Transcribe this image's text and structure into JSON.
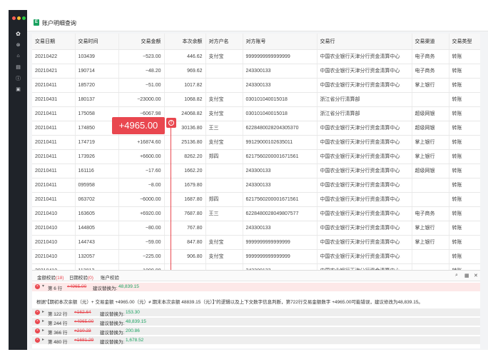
{
  "window": {
    "title": "账户明细查询",
    "app_icon_letter": "E"
  },
  "traffic_lights": [
    "#ff5f57",
    "#febc2e",
    "#28c840"
  ],
  "sidebar": {
    "icons": [
      "gear-icon",
      "nodes-icon",
      "box-icon",
      "document-icon",
      "info-icon",
      "book-icon"
    ]
  },
  "table": {
    "headers": [
      "交易日期",
      "交易时间",
      "交易金额",
      "本次余额",
      "对方户名",
      "对方账号",
      "交易行",
      "交易渠道",
      "交易类型"
    ],
    "rows": [
      [
        "20210422",
        "103439",
        "−523.00",
        "446.62",
        "支付宝",
        "9999999999999999",
        "中国农业银行天津分行资金清算中心",
        "电子商务",
        "转账"
      ],
      [
        "20210421",
        "190714",
        "−48.20",
        "969.62",
        "",
        "243300133",
        "中国农业银行天津分行资金清算中心",
        "电子商务",
        "转账"
      ],
      [
        "20210411",
        "185720",
        "−51.00",
        "1017.82",
        "",
        "243300133",
        "中国农业银行天津分行资金清算中心",
        "掌上银行",
        "转账"
      ],
      [
        "20210431",
        "180137",
        "−23000.00",
        "1068.82",
        "支付宝",
        "030101040015018",
        "浙江省分行清算部",
        "",
        "转账"
      ],
      [
        "20210411",
        "175058",
        "−6067.98",
        "24068.82",
        "支付宝",
        "030101040015018",
        "浙江省分行清算部",
        "超级网银",
        "转账"
      ],
      [
        "20210411",
        "174850",
        "",
        "30136.80",
        "王三",
        "6228480028204305370",
        "中国农业银行天津分行资金清算中心",
        "超级网银",
        "转账"
      ],
      [
        "20210411",
        "174719",
        "+16874.60",
        "25136.80",
        "支付宝",
        "99129000102635011",
        "中国农业银行天津分行资金清算中心",
        "掌上银行",
        "转账"
      ],
      [
        "20210411",
        "173926",
        "+6600.00",
        "8262.20",
        "郑四",
        "6217560200001671561",
        "中国农业银行天津分行资金清算中心",
        "掌上银行",
        "转账"
      ],
      [
        "20210411",
        "161116",
        "−17.60",
        "1662.20",
        "",
        "243300133",
        "中国农业银行天津分行资金清算中心",
        "超级网银",
        "转账"
      ],
      [
        "20210411",
        "095958",
        "−8.00",
        "1679.80",
        "",
        "243300133",
        "中国农业银行天津分行资金清算中心",
        "",
        "转账"
      ],
      [
        "20210411",
        "063702",
        "−6000.00",
        "1687.80",
        "郑四",
        "6217560200001671561",
        "中国农业银行天津分行资金清算中心",
        "",
        "转账"
      ],
      [
        "20210410",
        "163605",
        "+6920.00",
        "7687.80",
        "王三",
        "6228480028049807577",
        "中国农业银行天津分行资金清算中心",
        "电子商务",
        "转账"
      ],
      [
        "20210410",
        "144805",
        "−80.00",
        "767.80",
        "",
        "243300133",
        "中国农业银行天津分行资金清算中心",
        "掌上银行",
        "转账"
      ],
      [
        "20210410",
        "144743",
        "−59.00",
        "847.80",
        "支付宝",
        "9999999999999999",
        "中国农业银行天津分行资金清算中心",
        "掌上银行",
        "转账"
      ],
      [
        "20210410",
        "132057",
        "−225.00",
        "906.80",
        "支付宝",
        "9999999999999999",
        "中国农业银行天津分行资金清算中心",
        "",
        "转账"
      ],
      [
        "20210410",
        "113812",
        "−1000.00",
        "",
        "",
        "243300133",
        "中国农业银行天津分行资金清算中心",
        "",
        "转账"
      ]
    ]
  },
  "callout": {
    "amount": "+4965.00",
    "alert_glyph": "!"
  },
  "panel": {
    "tabs": [
      {
        "label": "金额校验",
        "count": "(18)"
      },
      {
        "label": "日期校验",
        "count": "(0)"
      },
      {
        "label": "账户校验",
        "count": ""
      }
    ],
    "main": {
      "row_label": "第 6 行",
      "old": "+4965.00",
      "suggest_label": "建议替换为:",
      "new": "48,839.15"
    },
    "explanation": "根据“【期初本次余额（元）+ 交易金额 +4965.00（元）≠ 期末本次余额 48839.15（元）】”的逻辑以及上下文数字信息判断，第722行交易金额数字 +4965.00可能错误，建议修改为48,839.15。",
    "subs": [
      {
        "row_label": "第 122 行",
        "old": "+162.64",
        "suggest_label": "建议替换为:",
        "new": "153.30"
      },
      {
        "row_label": "第 244 行",
        "old": "+4965.00",
        "suggest_label": "建议替换为:",
        "new": "48,839.15"
      },
      {
        "row_label": "第 366 行",
        "old": "+210.23",
        "suggest_label": "建议替换为:",
        "new": "200.86"
      },
      {
        "row_label": "第 480 行",
        "old": "+1681.29",
        "suggest_label": "建议替换为:",
        "new": "1,678.52"
      }
    ]
  }
}
